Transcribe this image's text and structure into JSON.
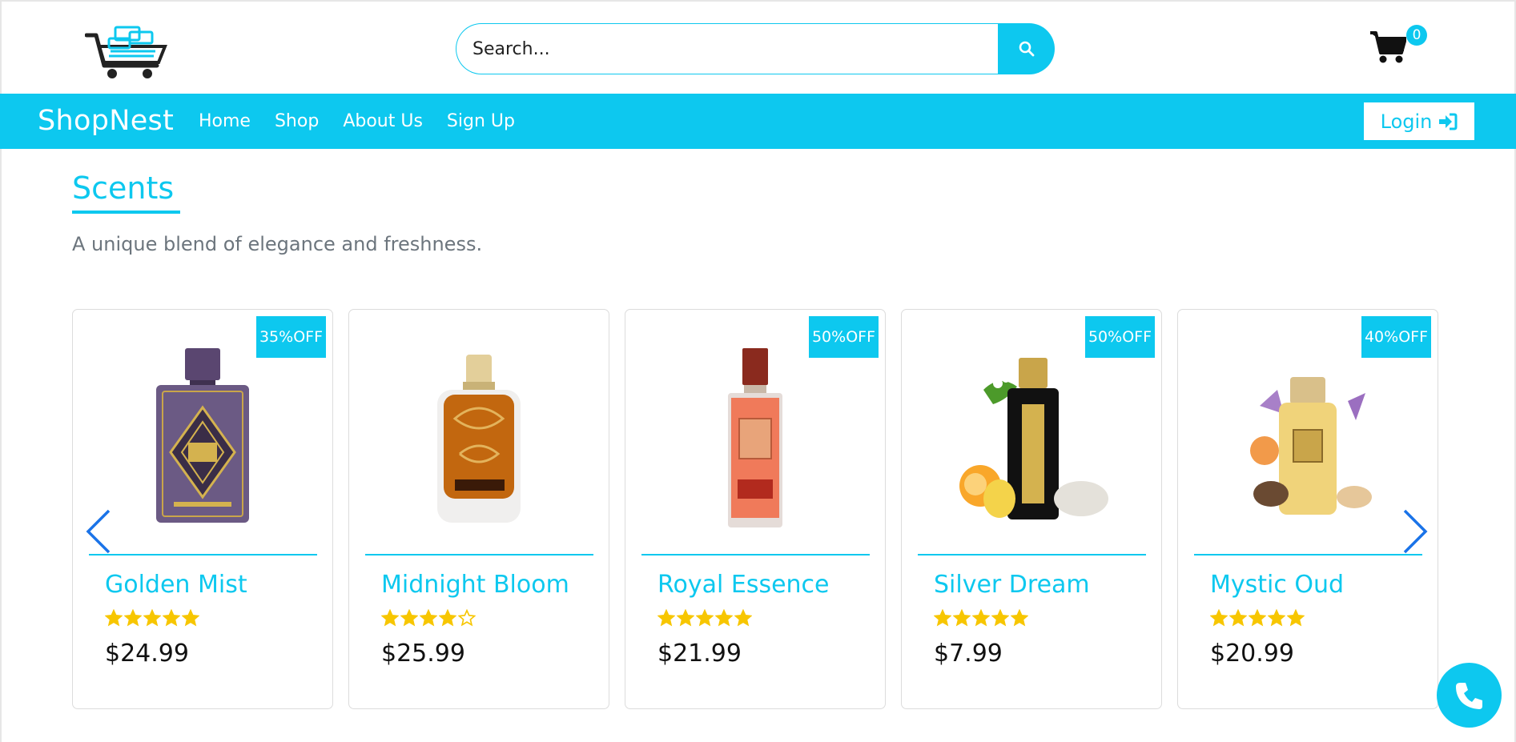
{
  "header": {
    "search_placeholder": "Search...",
    "cart_count": "0",
    "accent_color": "#0dc8ef"
  },
  "navbar": {
    "brand": "ShopNest",
    "links": [
      "Home",
      "Shop",
      "About Us",
      "Sign Up"
    ],
    "login_label": "Login"
  },
  "section": {
    "title": "Scents",
    "subtitle": "A unique blend of elegance and freshness."
  },
  "products": [
    {
      "name": "Golden Mist",
      "price": "$24.99",
      "discount": "35%OFF",
      "rating": 5,
      "bottle": "purple"
    },
    {
      "name": "Midnight Bloom",
      "price": "$25.99",
      "discount": "",
      "rating": 4,
      "bottle": "amber"
    },
    {
      "name": "Royal Essence",
      "price": "$21.99",
      "discount": "50%OFF",
      "rating": 5,
      "bottle": "coral"
    },
    {
      "name": "Silver Dream",
      "price": "$7.99",
      "discount": "50%OFF",
      "rating": 5,
      "bottle": "black"
    },
    {
      "name": "Mystic Oud",
      "price": "$20.99",
      "discount": "40%OFF",
      "rating": 5,
      "bottle": "gold"
    }
  ],
  "icons": {
    "logo": "shopping-cart-logo",
    "search": "search-icon",
    "cart": "cart-icon",
    "login": "sign-in-icon",
    "prev": "chevron-left-icon",
    "next": "chevron-right-icon",
    "call": "phone-icon",
    "star": "star-icon"
  },
  "colors": {
    "accent": "#0dc8ef",
    "star": "#f7c600",
    "text_muted": "#6c757d"
  }
}
